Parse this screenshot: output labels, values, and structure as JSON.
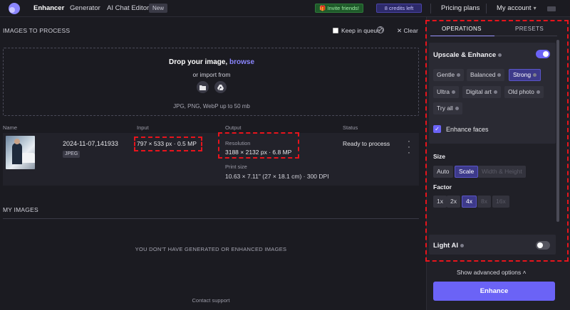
{
  "topbar": {
    "nav": [
      "Enhancer",
      "Generator",
      "AI Chat Editor"
    ],
    "new_badge": "New",
    "invite": "🎁 Invite friends!",
    "credits": "8 credits left",
    "pricing": "Pricing plans",
    "account": "My account"
  },
  "images": {
    "title": "IMAGES TO PROCESS",
    "keep_in_queue": "Keep in queue?",
    "clear": "Clear",
    "drop_title": "Drop your image,",
    "drop_browse": "browse",
    "drop_sub": "or import from",
    "drop_formats": "JPG, PNG, WebP up to 50 mb",
    "columns": [
      "Name",
      "Input",
      "Output",
      "Status"
    ],
    "row": {
      "name": "2024-11-07,141933",
      "format": "JPEG",
      "input": "797 × 533 px · 0.5 MP",
      "resolution_label": "Resolution",
      "resolution": "3188 × 2132 px · 6.8 MP",
      "print_label": "Print size",
      "print": "10.63 × 7.11\" (27 × 18.1 cm) · 300 DPI",
      "status": "Ready to process"
    }
  },
  "my_images": {
    "title": "MY IMAGES",
    "empty": "YOU DON'T HAVE GENERATED OR ENHANCED IMAGES",
    "support": "Contact support"
  },
  "panel": {
    "tabs": [
      "OPERATIONS",
      "PRESETS"
    ],
    "upscale_title": "Upscale & Enhance",
    "upscale_on": true,
    "modes": [
      "Gentle",
      "Balanced",
      "Strong",
      "Ultra",
      "Digital art",
      "Old photo",
      "Try all"
    ],
    "active_mode": "Strong",
    "enhance_faces": "Enhance faces",
    "size_label": "Size",
    "size_opts": [
      "Auto",
      "Scale",
      "Width & Height"
    ],
    "factor_label": "Factor",
    "factors": [
      "1x",
      "2x",
      "4x",
      "8x",
      "16x"
    ],
    "light_ai": "Light AI",
    "light_ai_on": false,
    "advanced": "Show advanced options",
    "enhance_btn": "Enhance"
  },
  "colors": {
    "accent": "#6b63f6",
    "highlight": "#e8141c",
    "background": "#1b1b21"
  }
}
